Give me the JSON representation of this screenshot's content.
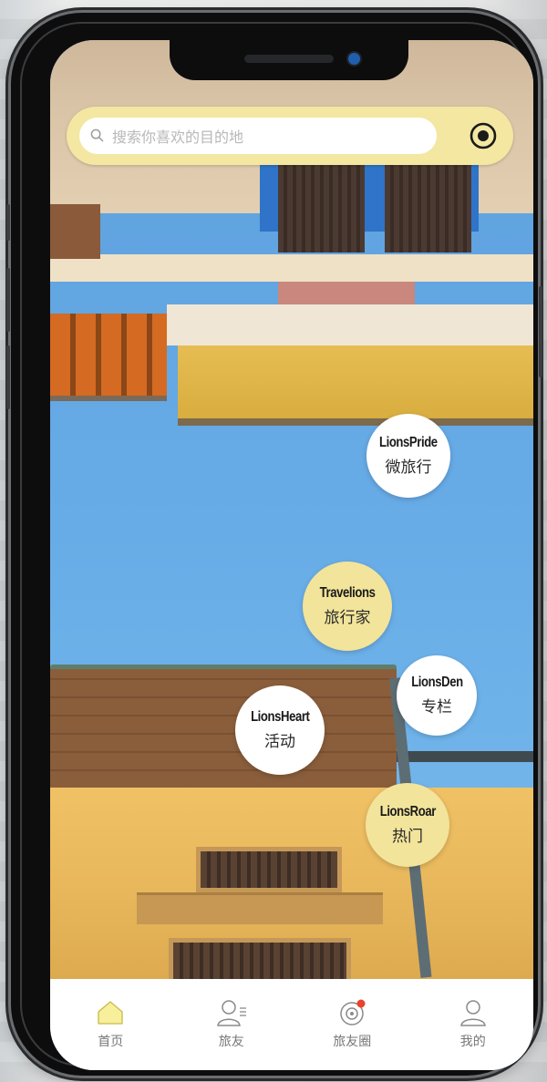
{
  "search": {
    "placeholder": "搜索你喜欢的目的地"
  },
  "bubbles": [
    {
      "en": "LionsPride",
      "zh": "微旅行",
      "style": "white"
    },
    {
      "en": "Travelions",
      "zh": "旅行家",
      "style": "yellow"
    },
    {
      "en": "LionsDen",
      "zh": "专栏",
      "style": "white"
    },
    {
      "en": "LionsHeart",
      "zh": "活动",
      "style": "white"
    },
    {
      "en": "LionsRoar",
      "zh": "热门",
      "style": "yellow"
    }
  ],
  "tabs": [
    {
      "label": "首页",
      "icon": "home-icon",
      "active": true
    },
    {
      "label": "旅友",
      "icon": "friends-icon",
      "active": false
    },
    {
      "label": "旅友圈",
      "icon": "moments-icon",
      "active": false,
      "badge": true
    },
    {
      "label": "我的",
      "icon": "profile-icon",
      "active": false
    }
  ],
  "colors": {
    "accent_yellow": "#f2e49a",
    "search_bar": "#f3e7a2",
    "badge_red": "#e8432b",
    "home_icon_fill": "#f7ef9c"
  }
}
